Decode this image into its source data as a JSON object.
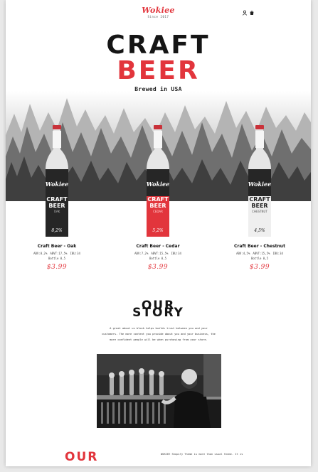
{
  "header": {
    "logo": "Wokiee",
    "since": "Since 2017",
    "icons": [
      "user-icon",
      "cart-icon"
    ]
  },
  "hero": {
    "title_line1": "CRAFT",
    "title_line2": "BEER",
    "subtitle": "Brewed in USA"
  },
  "products": [
    {
      "name": "Craft Beer - Oak",
      "abv": "ABV:8,2%",
      "abvt": "ABVT:17,5%",
      "ibu": "IBU:34",
      "bottle": "Bottle 0,5",
      "price": "$3.99",
      "label_top": "CRAFT",
      "label_bottom": "BEER",
      "variant": "OAK",
      "badge": "8,2%",
      "bottle_color": "#222222"
    },
    {
      "name": "Craft Beer - Cedar",
      "abv": "ABV:7,2%",
      "abvt": "ABVT:15,5%",
      "ibu": "IBU:34",
      "bottle": "Bottle 0,5",
      "price": "$3.99",
      "label_top": "CRAFT",
      "label_bottom": "BEER",
      "variant": "CEDAR",
      "badge": "5,2%",
      "bottle_color": "#e2353c"
    },
    {
      "name": "Craft Beer - Chestnut",
      "abv": "ABV:4,5%",
      "abvt": "ABVT:15,5%",
      "ibu": "IBU:34",
      "bottle": "Bottle 0,5",
      "price": "$3.99",
      "label_top": "CRAFT",
      "label_bottom": "BEER",
      "variant": "CHESTNUT",
      "badge": "4,5%",
      "bottle_color": "#eeeeee"
    }
  ],
  "story": {
    "title_line1": "OUR",
    "title_line2": "STORY",
    "text_lines": [
      "A great about us block helps builds trust between you and your",
      "customers. The more content you provide about you and your business, the",
      "more confident people will be when purchasing from your store."
    ]
  },
  "section_bottom": {
    "title_partial": "OUR",
    "text_lines": [
      "WOKIEE Shopify Theme is more than usual theme. It is"
    ]
  },
  "colors": {
    "accent": "#e2353c",
    "dark": "#151515",
    "page_background": "#ffffff",
    "outer_background": "#e9e9e9"
  }
}
